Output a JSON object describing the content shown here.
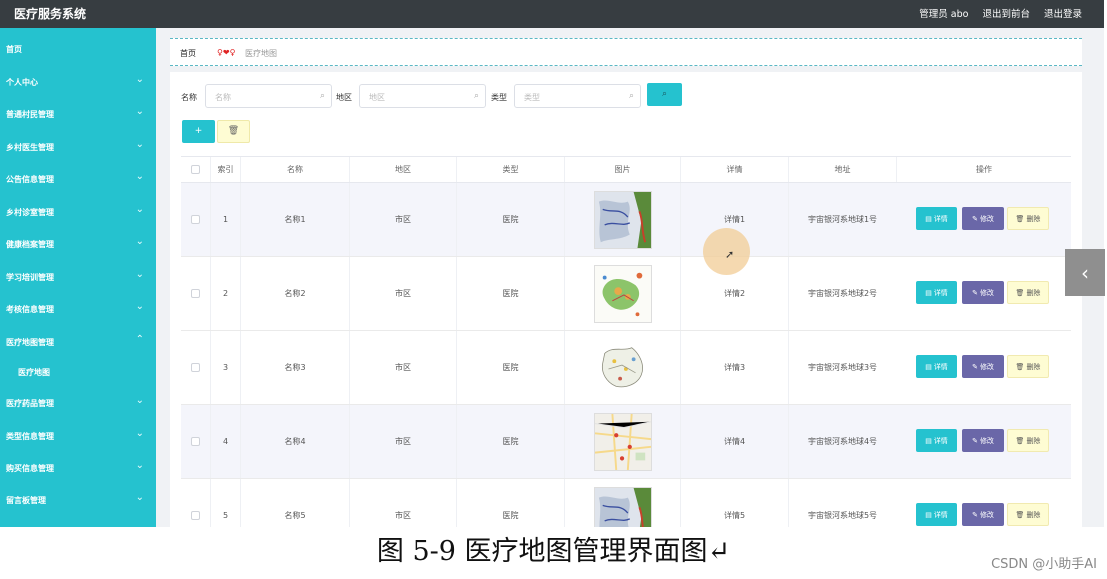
{
  "app": {
    "title": "医疗服务系统",
    "links": [
      "管理员 abo",
      "退出到前台",
      "退出登录"
    ]
  },
  "sidebar": {
    "items": [
      {
        "label": "首页",
        "chevron": ""
      },
      {
        "label": "个人中心",
        "chevron": "⌄"
      },
      {
        "label": "普通村民管理",
        "chevron": "⌄"
      },
      {
        "label": "乡村医生管理",
        "chevron": "⌄"
      },
      {
        "label": "公告信息管理",
        "chevron": "⌄"
      },
      {
        "label": "乡村诊室管理",
        "chevron": "⌄"
      },
      {
        "label": "健康档案管理",
        "chevron": "⌄"
      },
      {
        "label": "学习培训管理",
        "chevron": "⌄"
      },
      {
        "label": "考核信息管理",
        "chevron": "⌄"
      },
      {
        "label": "医疗地图管理",
        "chevron": "⌃"
      },
      {
        "label": "医疗地图",
        "chevron": ""
      },
      {
        "label": "医疗药品管理",
        "chevron": "⌄"
      },
      {
        "label": "类型信息管理",
        "chevron": "⌄"
      },
      {
        "label": "购买信息管理",
        "chevron": "⌄"
      },
      {
        "label": "留言板管理",
        "chevron": "⌄"
      }
    ]
  },
  "breadcrumb": {
    "home": "首页",
    "mark": "♀❤♀",
    "current": "医疗地图"
  },
  "filters": {
    "name_label": "名称",
    "name_placeholder": "名称",
    "region_label": "地区",
    "region_placeholder": "地区",
    "type_label": "类型",
    "type_placeholder": "类型",
    "search_icon": "⌕"
  },
  "actions": {
    "add_icon": "+",
    "delete_icon": "🗑"
  },
  "table": {
    "columns": [
      "",
      "索引",
      "名称",
      "地区",
      "类型",
      "图片",
      "详情",
      "地址",
      "操作"
    ],
    "rows": [
      {
        "index": "1",
        "name": "名称1",
        "region": "市区",
        "type": "医院",
        "detail": "详情1",
        "address": "宇宙银河系地球1号"
      },
      {
        "index": "2",
        "name": "名称2",
        "region": "市区",
        "type": "医院",
        "detail": "详情2",
        "address": "宇宙银河系地球2号"
      },
      {
        "index": "3",
        "name": "名称3",
        "region": "市区",
        "type": "医院",
        "detail": "详情3",
        "address": "宇宙银河系地球3号"
      },
      {
        "index": "4",
        "name": "名称4",
        "region": "市区",
        "type": "医院",
        "detail": "详情4",
        "address": "宇宙银河系地球4号"
      },
      {
        "index": "5",
        "name": "名称5",
        "region": "市区",
        "type": "医院",
        "detail": "详情5",
        "address": "宇宙银河系地球5号"
      }
    ],
    "op_labels": {
      "detail": "详情",
      "edit": "修改",
      "delete": "删除"
    }
  },
  "side_tab": {
    "icon": "‹"
  },
  "caption": "图 5-9 医疗地图管理界面图↵",
  "watermark": "CSDN @小助手AI",
  "colors": {
    "accent": "#25c2cf",
    "topbar": "#373d41",
    "edit": "#6a67a8",
    "delete": "#fefcd3"
  }
}
